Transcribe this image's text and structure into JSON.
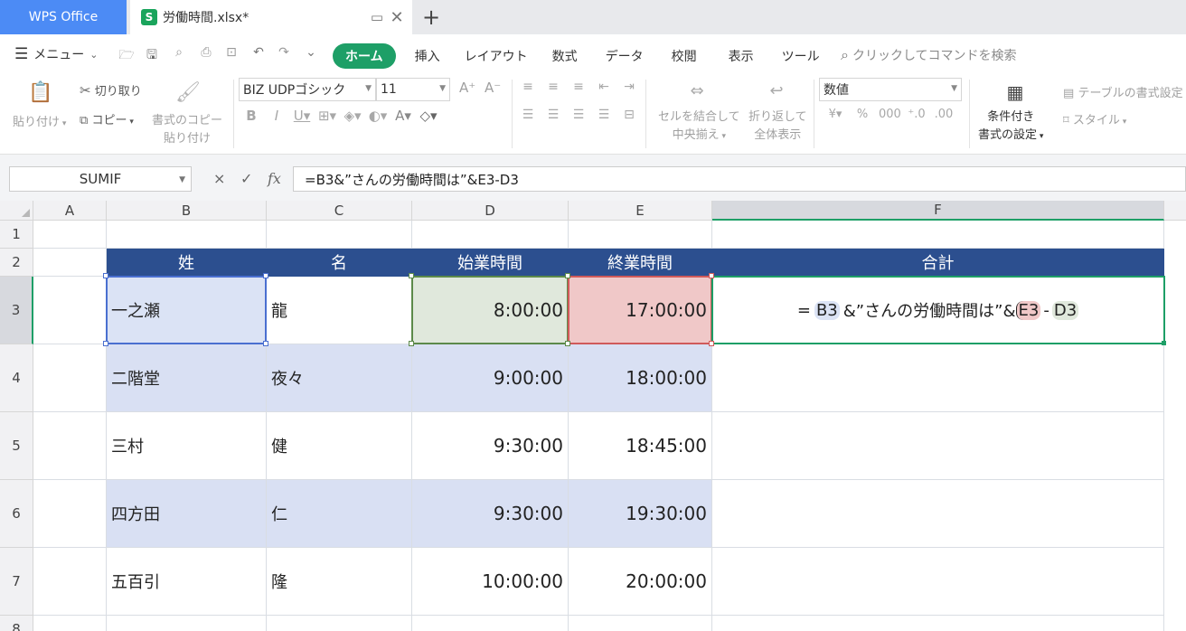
{
  "titlebar": {
    "app_tab": "WPS Office",
    "file_tab": "労働時間.xlsx*",
    "file_icon_letter": "S",
    "new_tab_symbol": "+"
  },
  "menubar": {
    "menu_label": "メニュー",
    "ribbon_tabs": [
      "ホーム",
      "挿入",
      "レイアウト",
      "数式",
      "データ",
      "校閲",
      "表示",
      "ツール"
    ],
    "active_tab": "ホーム",
    "command_search": "クリックしてコマンドを検索"
  },
  "ribbon": {
    "paste": "貼り付け",
    "cut": "切り取り",
    "copy": "コピー",
    "format_painter_1": "書式のコピー",
    "format_painter_2": "貼り付け",
    "font_name": "BIZ UDPゴシック",
    "font_size": "11",
    "merge_1": "セルを結合して",
    "merge_2": "中央揃え",
    "wrap_1": "折り返して",
    "wrap_2": "全体表示",
    "number_format": "数値",
    "conditional_1": "条件付き",
    "conditional_2": "書式の設定",
    "table_format": "テーブルの書式設定",
    "style": "スタイル"
  },
  "formula_bar": {
    "name_box": "SUMIF",
    "cancel": "×",
    "confirm": "✓",
    "fx": "fx",
    "formula": "=B3&”さんの労働時間は”&E3-D3"
  },
  "sheet": {
    "columns": [
      "A",
      "B",
      "C",
      "D",
      "E",
      "F"
    ],
    "selected_column": "F",
    "rows": [
      "1",
      "2",
      "3",
      "4",
      "5",
      "6",
      "7",
      "8"
    ],
    "selected_row": "3",
    "headers": {
      "sei": "姓",
      "mei": "名",
      "start": "始業時間",
      "end": "終業時間",
      "total": "合計"
    },
    "data": [
      {
        "sei": "一之瀬",
        "mei": "龍",
        "start": "8:00:00",
        "end": "17:00:00"
      },
      {
        "sei": "二階堂",
        "mei": "夜々",
        "start": "9:00:00",
        "end": "18:00:00"
      },
      {
        "sei": "三村",
        "mei": "健",
        "start": "9:30:00",
        "end": "18:45:00"
      },
      {
        "sei": "四方田",
        "mei": "仁",
        "start": "9:30:00",
        "end": "19:30:00"
      },
      {
        "sei": "五百引",
        "mei": "隆",
        "start": "10:00:00",
        "end": "20:00:00"
      }
    ],
    "editing_formula": {
      "eq": "=",
      "ref1": "B3",
      "mid": "&”さんの労働時間は”&",
      "ref2": "E3",
      "op": "-",
      "ref3": "D3"
    },
    "colors": {
      "header_bg": "#2c4f8f",
      "band_bg": "#d9e0f3",
      "ref_b3": "#dbe3f5",
      "ref_d3": "#e0e8dc",
      "ref_e3": "#f0c8c8",
      "active_border": "#1e9f67"
    }
  }
}
